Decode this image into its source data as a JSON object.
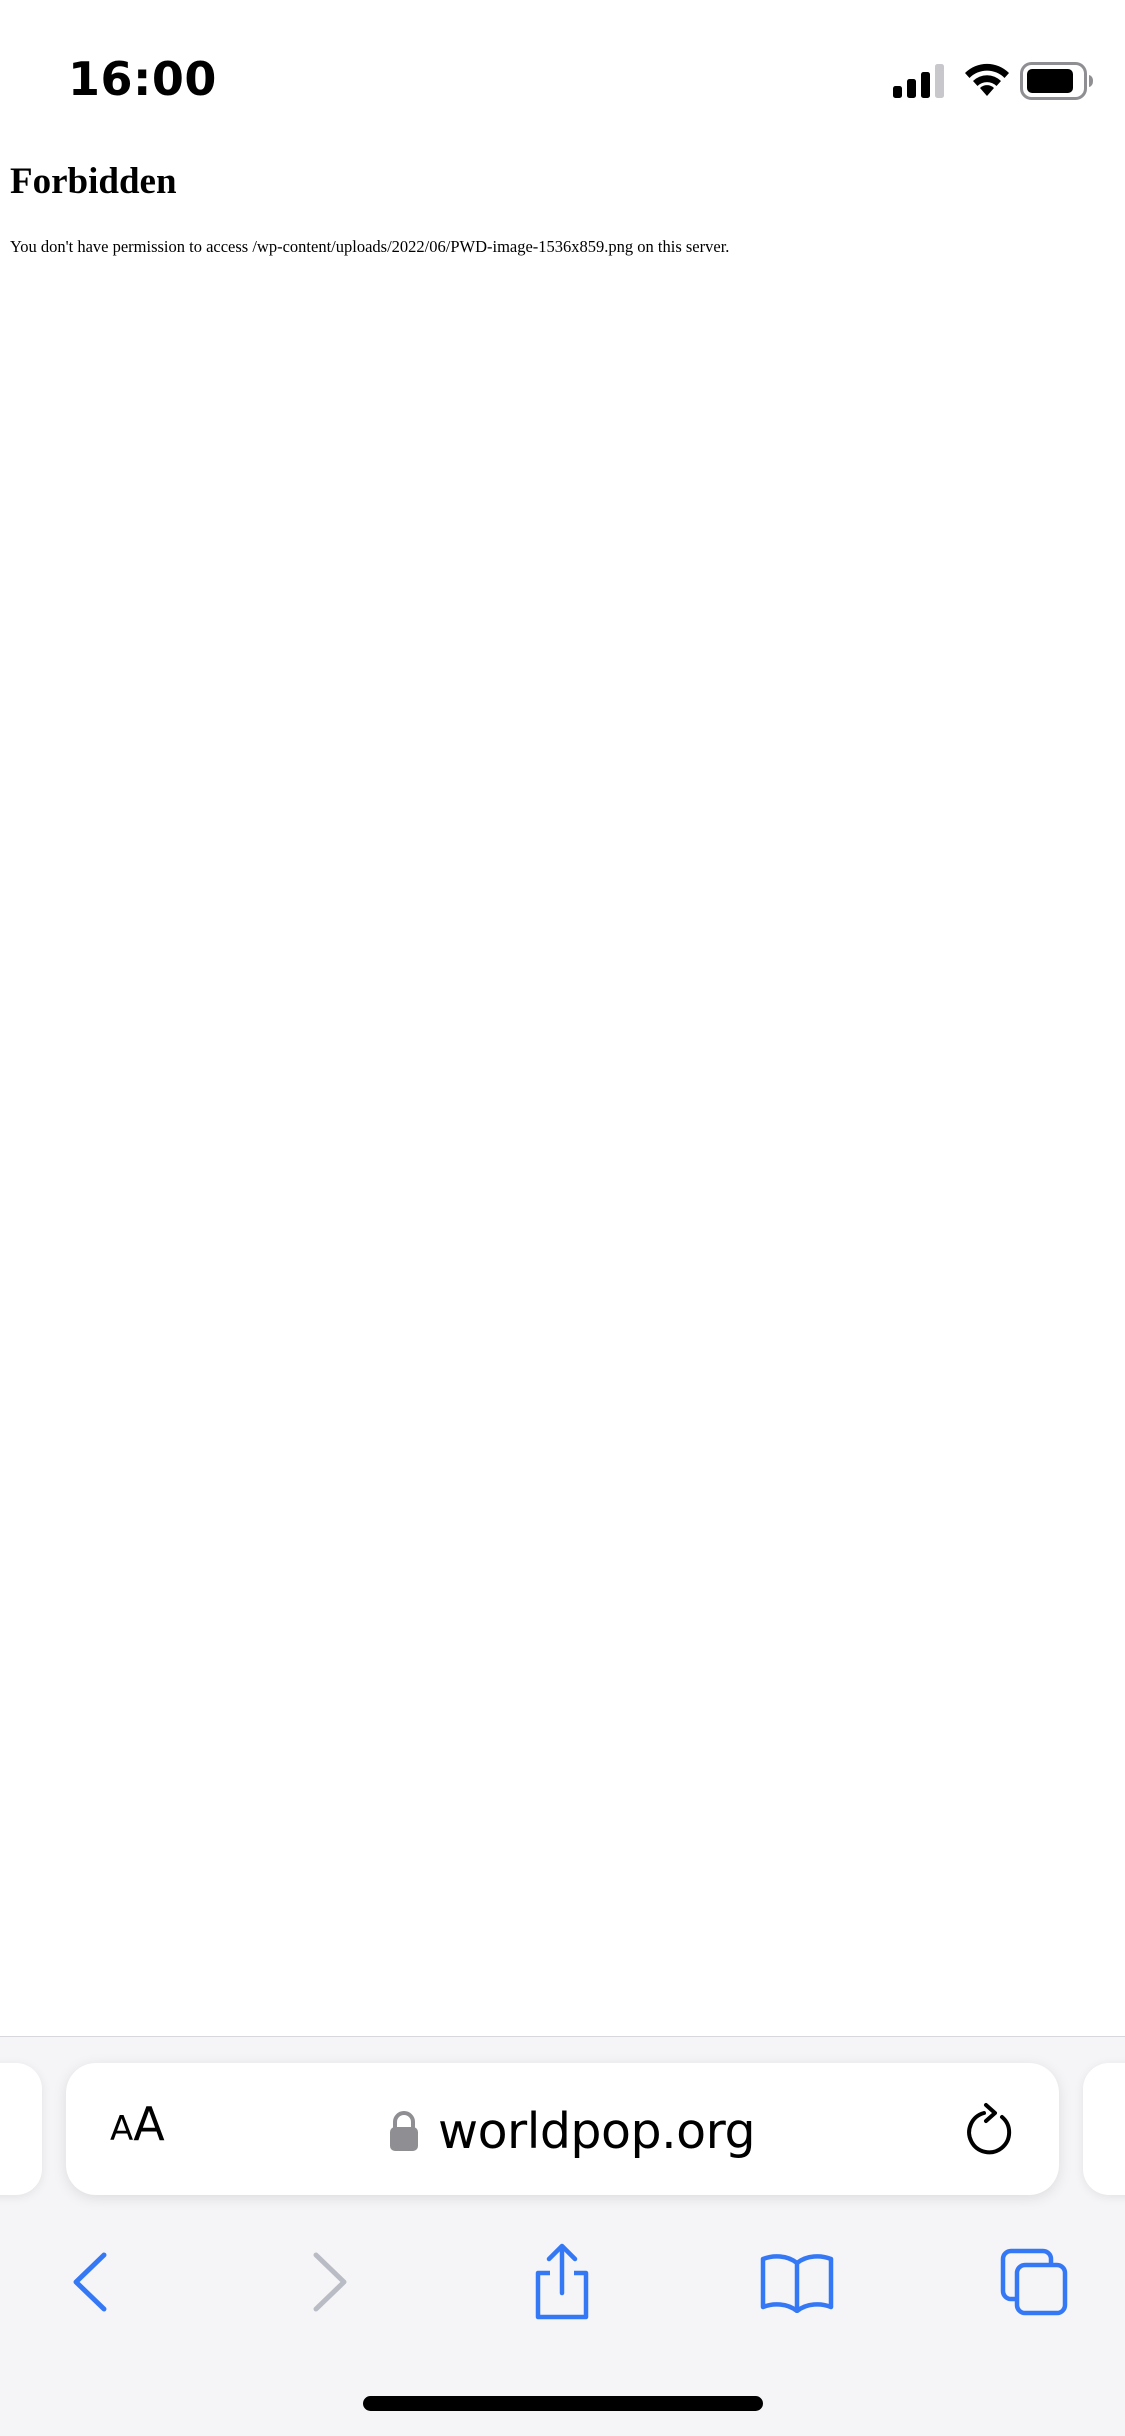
{
  "status_bar": {
    "time": "16:00",
    "icons": [
      "signal-icon",
      "wifi-icon",
      "battery-icon"
    ]
  },
  "page": {
    "title": "Forbidden",
    "message": "You don't have permission to access /wp-content/uploads/2022/06/PWD-image-1536x859.png on this server."
  },
  "browser": {
    "text_size_label_small": "A",
    "text_size_label_large": "A",
    "url": "worldpop.org",
    "icons": [
      "lock-icon",
      "reload-icon",
      "back-icon",
      "forward-icon",
      "share-icon",
      "bookmarks-icon",
      "tabs-icon"
    ]
  },
  "colors": {
    "accent": "#3478f6",
    "disabled": "#b9bcc4",
    "chrome_background": "#f5f5f7"
  }
}
